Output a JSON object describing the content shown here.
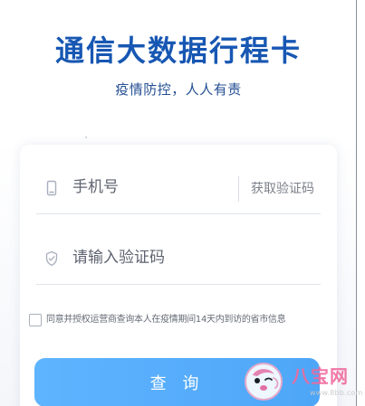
{
  "header": {
    "title": "通信大数据行程卡",
    "subtitle": "疫情防控，人人有责"
  },
  "form": {
    "phone_placeholder": "手机号",
    "get_code_label": "获取验证码",
    "code_placeholder": "请输入验证码",
    "consent_text": "同意并授权运营商查询本人在疫情期间14天内到访的省市信息",
    "submit_label": "查 询"
  },
  "icons": {
    "phone": "phone-icon",
    "shield": "shield-check-icon",
    "checkbox": "checkbox-unchecked"
  },
  "watermark": {
    "brand": "八宝网",
    "domain": "www.8bb.com"
  },
  "colors": {
    "title": "#1757b3",
    "button": "#4ea6f7",
    "icon": "#a8afbd",
    "watermark": "#f06a9d"
  }
}
